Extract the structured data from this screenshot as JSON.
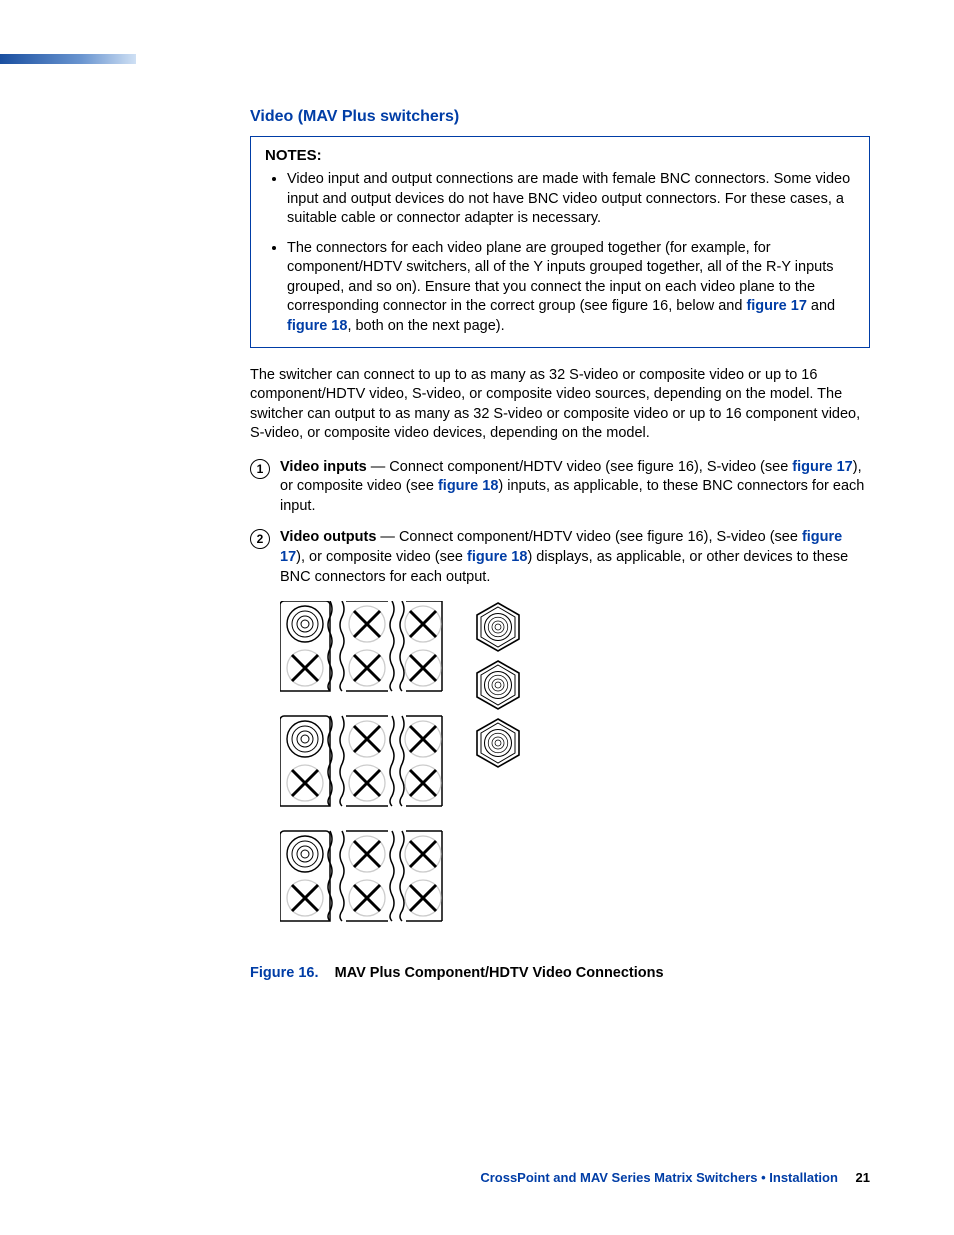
{
  "heading": "Video (MAV Plus switchers)",
  "notes": {
    "title": "NOTES:",
    "items": [
      "Video input and output connections are made with female BNC connectors. Some video input and output devices do not have BNC video output connectors. For these cases, a suitable cable or connector adapter is necessary.",
      "The connectors for each video plane are grouped together (for example, for component/HDTV switchers, all of the Y inputs grouped together, all of the R-Y inputs grouped, and so on). Ensure that you connect the input on each video plane to the corresponding connector in the correct group (see figure 16, below and "
    ],
    "note2_link1": "figure 17",
    "note2_mid": " and ",
    "note2_link2": "figure 18",
    "note2_tail": ", both on the next page)."
  },
  "para": "The switcher can connect to up to as many as 32 S-video or composite video or up to 16 component/HDTV video, S-video, or composite video sources, depending on the model. The switcher can output to as many as 32 S-video or composite video or up to 16 component video, S-video, or composite video devices, depending on the model.",
  "items": [
    {
      "num": "1",
      "title": "Video inputs",
      "pre": " — Connect component/HDTV video (see figure 16), S-video (see ",
      "link1": "figure 17",
      "mid": "), or composite video (see ",
      "link2": "figure 18",
      "post": ") inputs, as applicable, to these BNC connectors for each input."
    },
    {
      "num": "2",
      "title": "Video outputs",
      "pre": " — Connect component/HDTV video (see figure 16), S-video (see ",
      "link1": "figure 17",
      "mid": "), or composite video (see ",
      "link2": "figure 18",
      "post": ") displays, as applicable, or other devices to these BNC connectors for each output."
    }
  ],
  "figure": {
    "num": "Figure 16.",
    "title": "MAV Plus Component/HDTV Video Connections"
  },
  "footer": {
    "doc": "CrossPoint and MAV Series Matrix Switchers • Installation",
    "page": "21"
  }
}
